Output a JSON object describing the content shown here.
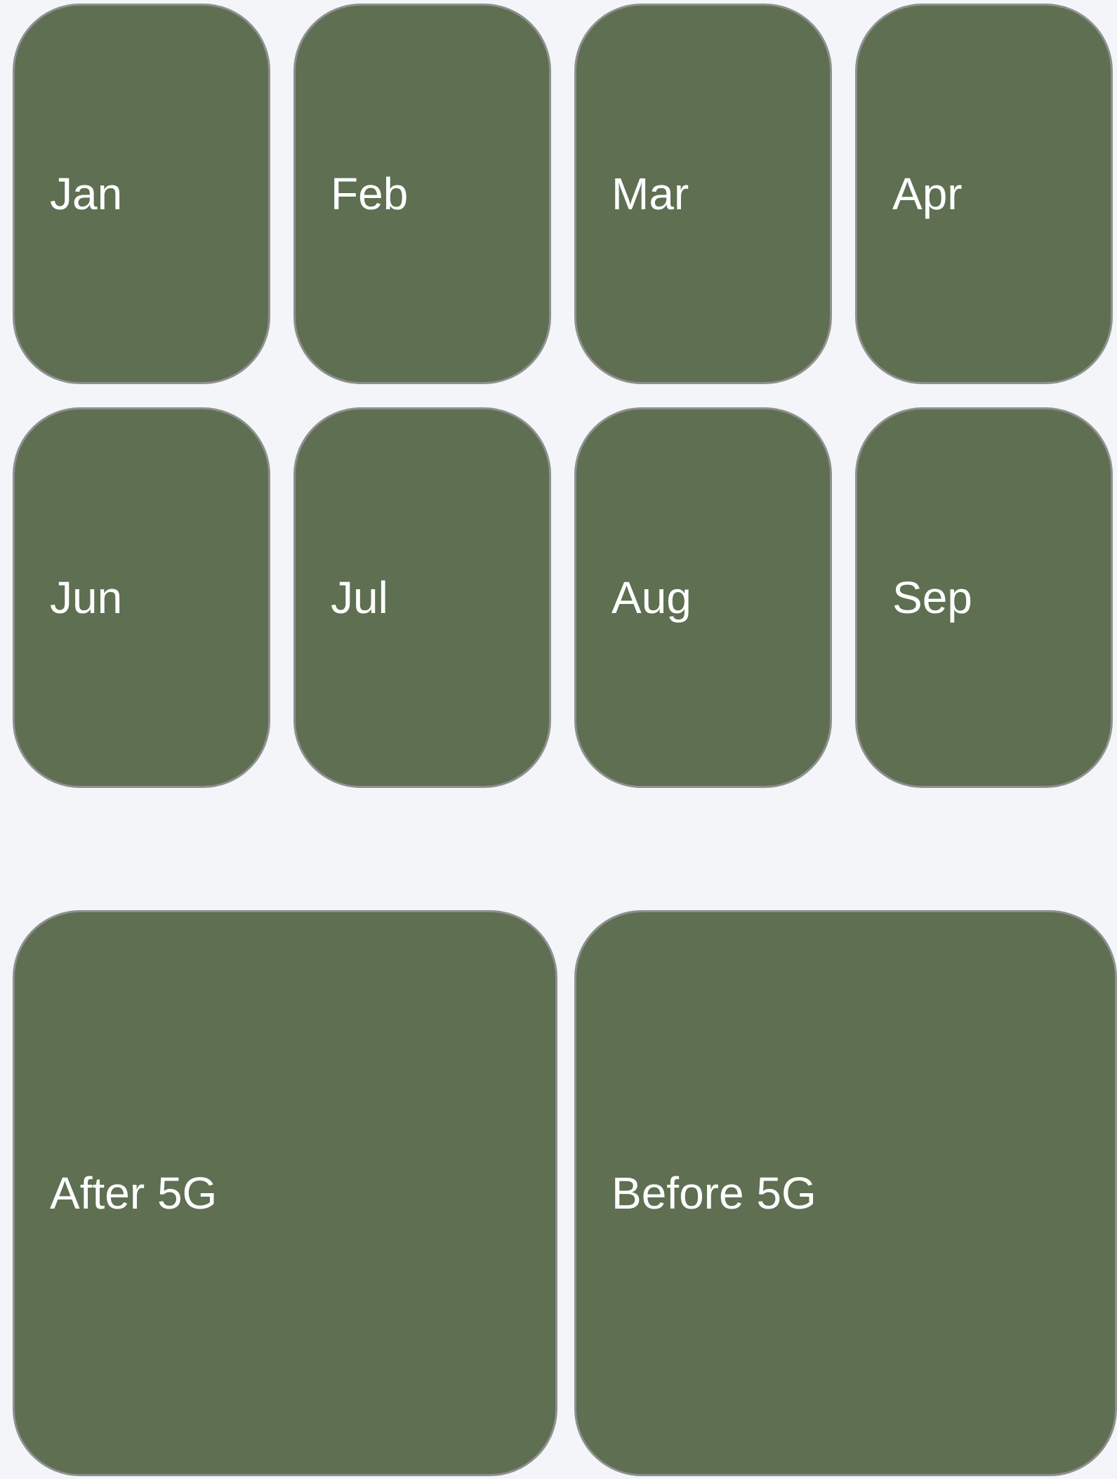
{
  "colors": {
    "background": "#f3f5f9",
    "tile_fill": "#5e6f52",
    "tile_border": "#8f8f8f",
    "label_text": "#ffffff"
  },
  "months_row_1": [
    {
      "label": "Jan"
    },
    {
      "label": "Feb"
    },
    {
      "label": "Mar"
    },
    {
      "label": "Apr"
    }
  ],
  "months_row_2": [
    {
      "label": "Jun"
    },
    {
      "label": "Jul"
    },
    {
      "label": "Aug"
    },
    {
      "label": "Sep"
    }
  ],
  "periods": [
    {
      "label": "After 5G"
    },
    {
      "label": "Before 5G"
    }
  ]
}
